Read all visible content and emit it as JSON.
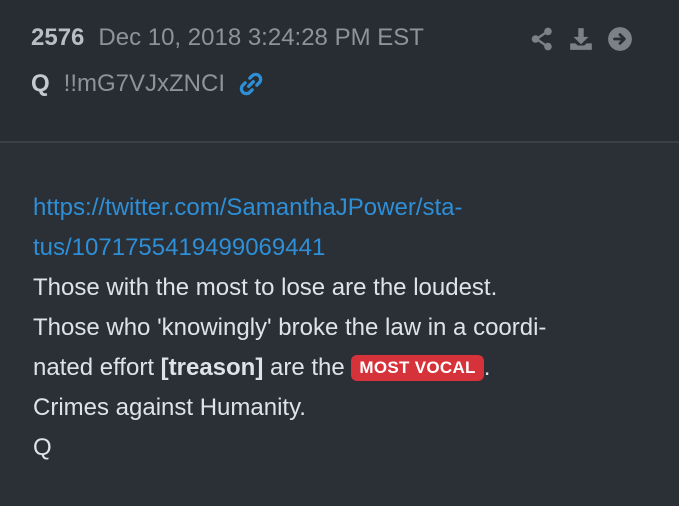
{
  "post": {
    "number": "2576",
    "date": "Dec 10, 2018 3:24:28 PM EST",
    "author": "Q",
    "tripcode": "!!mG7VJxZNCI"
  },
  "icons": {
    "link": "link-icon",
    "share": "share-icon",
    "download": "download-icon",
    "next": "arrow-circle-right-icon"
  },
  "colors": {
    "background": "#2b2f36",
    "link": "#2e8fd6",
    "badge": "#d6323a"
  },
  "content": {
    "url_line1": "https://twitter.com/SamanthaJPower/sta-",
    "url_line2": "tus/1071755419499069441",
    "line1": "Those with the most to lose are the loudest.",
    "line2": "Those who 'knowingly' broke the law in a coordi-",
    "line3_pre": "nated effort ",
    "line3_bold": "[treason]",
    "line3_mid": " are the ",
    "line3_badge": "MOST VOCAL",
    "line3_post": ".",
    "line4": "Crimes against Humanity.",
    "signature": "Q"
  }
}
